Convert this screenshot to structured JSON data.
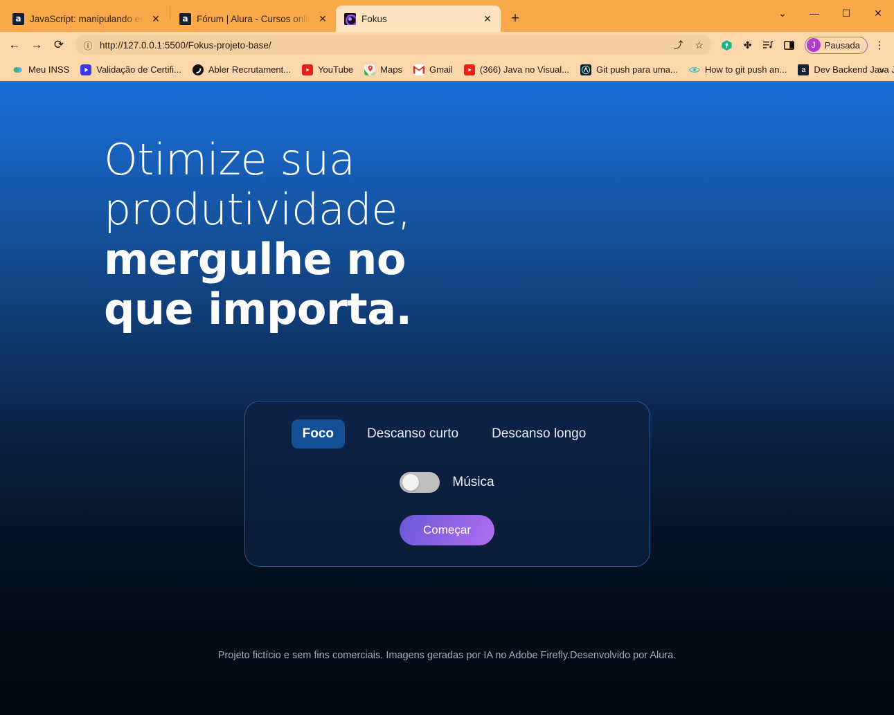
{
  "browser": {
    "tabs": [
      {
        "title": "JavaScript: manipulando element",
        "favicon": "alura-icon",
        "active": false,
        "close_label": "✕"
      },
      {
        "title": "Fórum | Alura - Cursos online de",
        "favicon": "alura-icon",
        "active": false,
        "close_label": "✕"
      },
      {
        "title": "Fokus",
        "favicon": "fokus-icon",
        "active": true,
        "close_label": "✕"
      }
    ],
    "new_tab_label": "+",
    "window_controls": {
      "tab_search": "⌄",
      "minimize": "—",
      "maximize": "☐",
      "close": "✕"
    },
    "toolbar": {
      "back": "←",
      "forward": "→",
      "reload": "⟳",
      "site_info_icon": "ⓘ",
      "url": "http://127.0.0.1:5500/Fokus-projeto-base/",
      "share": "⤴",
      "bookmark_star": "☆",
      "password_manager": "⚷",
      "extensions": "✤",
      "media_control": "♫",
      "side_panel": "▣",
      "profile_initial": "J",
      "profile_name": "Pausada",
      "menu": "⋮"
    },
    "bookmarks": [
      {
        "label": "Meu INSS",
        "icon": "inss-icon",
        "glyph": "◉"
      },
      {
        "label": "Validação de Certifi...",
        "icon": "validacao-icon",
        "glyph": "▶"
      },
      {
        "label": "Abler Recrutament...",
        "icon": "abler-icon",
        "glyph": "◐"
      },
      {
        "label": "YouTube",
        "icon": "youtube-icon",
        "glyph": "▶"
      },
      {
        "label": "Maps",
        "icon": "maps-icon",
        "glyph": "⚑"
      },
      {
        "label": "Gmail",
        "icon": "gmail-icon",
        "glyph": "M"
      },
      {
        "label": "(366) Java no Visual...",
        "icon": "youtube-icon",
        "glyph": "▶"
      },
      {
        "label": "Git push para uma...",
        "icon": "git-icon",
        "glyph": "Ⓐ"
      },
      {
        "label": "How to git push an...",
        "icon": "eye-icon",
        "glyph": "◉"
      },
      {
        "label": "Dev Backend Java J...",
        "icon": "alura-icon",
        "glyph": "a"
      }
    ],
    "bookmarks_overflow": "»"
  },
  "page": {
    "hero": {
      "line1": "Otimize sua",
      "line2": "produtividade,",
      "line3": "mergulhe no",
      "line4": "que importa."
    },
    "card": {
      "modes": [
        {
          "label": "Foco",
          "active": true
        },
        {
          "label": "Descanso curto",
          "active": false
        },
        {
          "label": "Descanso longo",
          "active": false
        }
      ],
      "music_label": "Música",
      "music_enabled": false,
      "start_label": "Começar"
    },
    "footer": "Projeto fictício e sem fins comerciais. Imagens geradas por IA no Adobe Firefly.Desenvolvido por Alura."
  },
  "colors": {
    "chrome_accent": "#f9a94a",
    "chrome_toolbar": "#fbd7ab",
    "active_tab": "#fde3c0",
    "page_top": "#1a6fdb",
    "page_bottom": "#020810",
    "card_bg": "#0e2142",
    "card_border": "#2c5691",
    "mode_active": "#144e95",
    "start_gradient_from": "#6a5ad8",
    "start_gradient_to": "#b06ef0",
    "switch_track": "#bfbfbf",
    "profile_avatar": "#b23fc9"
  }
}
